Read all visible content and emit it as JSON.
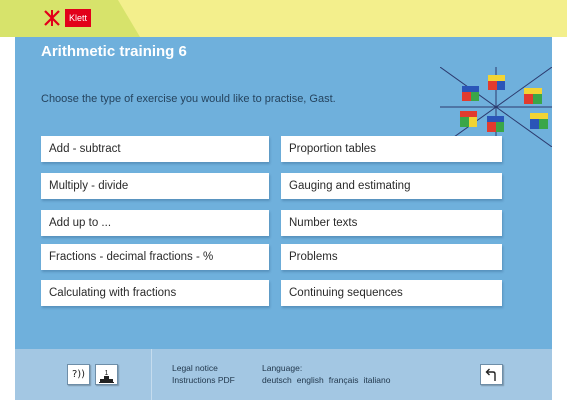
{
  "brand": {
    "logo_text": "Klett"
  },
  "app": {
    "title": "Arithmetic training 6",
    "instruction": "Choose the type of exercise you would like to practise, Gast."
  },
  "exercises": {
    "left": [
      "Add - subtract",
      "Multiply - divide",
      "Add up to ...",
      "Fractions - decimal fractions - %",
      "Calculating with fractions"
    ],
    "right": [
      "Proportion tables",
      "Gauging and estimating",
      "Number texts",
      "Problems",
      "Continuing sequences"
    ]
  },
  "footer": {
    "help_label": "?))",
    "ranking_label": "1",
    "legal_notice": "Legal notice",
    "instructions_pdf": "Instructions PDF",
    "language_label": "Language:",
    "languages": [
      "deutsch",
      "english",
      "français",
      "italiano"
    ]
  },
  "icons": {
    "logo": "klett-logo-mark",
    "decor": "colored-cubes-star-decoration",
    "help": "audio-help-icon",
    "ranking": "podium-icon",
    "back": "back-arrow-icon"
  },
  "colors": {
    "main_bg": "#6fb0dc",
    "footer_bg": "#a3c7e3",
    "top_bar": "#f3ef8c",
    "brand_red": "#e2001a"
  }
}
